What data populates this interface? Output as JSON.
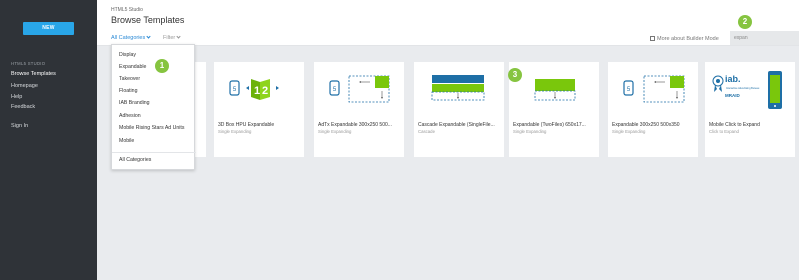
{
  "sidebar": {
    "new_label": "NEW",
    "section_label": "HTML5 STUDIO",
    "items": [
      {
        "label": "Browse Templates"
      },
      {
        "label": "Homepage"
      },
      {
        "label": "Help"
      },
      {
        "label": "Feedback"
      },
      {
        "label": "Sign In"
      }
    ]
  },
  "header": {
    "app_title": "HTML5 Studio",
    "page_title": "Browse Templates",
    "category_filter": "All Categories",
    "filter_label": "Filter",
    "builder_link": "More about Builder Mode",
    "search_value": "expan"
  },
  "dropdown": {
    "items": [
      "Display",
      "Expandable",
      "Takeover",
      "Floating",
      "IAB Branding",
      "Adhesion",
      "Mobile Rising Stars Ad Units",
      "Mobile"
    ],
    "all_label": "All Categories"
  },
  "cards": [
    {
      "name": "3D Box HPU Expandable",
      "subtitle": "Single Expanding"
    },
    {
      "name": "AdTx Expandable 300x250 500...",
      "subtitle": "Single Expanding"
    },
    {
      "name": "Cascade Expandable (SingleFile...",
      "subtitle": "Cascade"
    },
    {
      "name": "Expandable (TwoFiles) 650x17...",
      "subtitle": "Single Expanding"
    },
    {
      "name": "Expandable 300x250 500x350",
      "subtitle": "Single Expanding"
    },
    {
      "name": "Mobile Click to Expand",
      "subtitle": "Click to Expand"
    }
  ],
  "thumbs": {
    "cube_digits": "1 2",
    "iab_text": "iab.",
    "iab_small": "Interactive Advertising Bureau",
    "mraid_text": "MRAID"
  },
  "callouts": [
    "1",
    "2",
    "3"
  ],
  "colors": {
    "accent_blue": "#29a6e8",
    "callout_green": "#86c440",
    "sidebar_bg": "#2f3338",
    "thumb_green": "#7ac70c",
    "thumb_blue": "#1e6fa6"
  }
}
